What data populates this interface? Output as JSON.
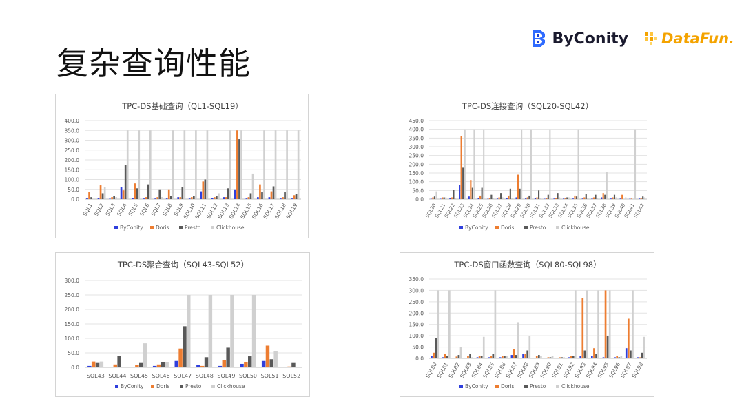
{
  "slide": {
    "title": "复杂查询性能"
  },
  "logos": {
    "byconity": "ByConity",
    "datafun": "DataFun."
  },
  "colors": {
    "ByConity": "#2f3fdc",
    "Doris": "#ed7d31",
    "Presto": "#595959",
    "Clickhouse": "#d0d0d0"
  },
  "chart_data": [
    {
      "type": "bar",
      "title": "TPC-DS基础查询（QL1-SQL19）",
      "ylim": [
        0,
        400
      ],
      "yticks": [
        "0.0",
        "50.0",
        "100.0",
        "150.0",
        "200.0",
        "250.0",
        "300.0",
        "350.0",
        "400.0"
      ],
      "legend_position": "bottom",
      "categories": [
        "SQL1",
        "SQL2",
        "SQL3",
        "SQL4",
        "SQL5",
        "SQL6",
        "SQL7",
        "SQL8",
        "SQL9",
        "SQL10",
        "SQL11",
        "SQL12",
        "SQL13",
        "SQL14",
        "SQL15",
        "SQL16",
        "SQL17",
        "SQL18",
        "SQL19"
      ],
      "series": [
        {
          "name": "ByConity",
          "values": [
            5,
            5,
            2,
            60,
            5,
            3,
            3,
            3,
            10,
            3,
            40,
            5,
            10,
            50,
            3,
            10,
            10,
            3,
            3
          ]
        },
        {
          "name": "Doris",
          "values": [
            35,
            70,
            10,
            45,
            80,
            10,
            10,
            50,
            10,
            10,
            90,
            10,
            10,
            350,
            10,
            75,
            40,
            10,
            20
          ]
        },
        {
          "name": "Presto",
          "values": [
            10,
            30,
            15,
            175,
            55,
            75,
            50,
            15,
            60,
            15,
            100,
            15,
            55,
            305,
            30,
            35,
            65,
            35,
            25
          ]
        },
        {
          "name": "Clickhouse",
          "values": [
            0,
            60,
            10,
            350,
            350,
            350,
            10,
            350,
            350,
            350,
            350,
            30,
            350,
            350,
            130,
            350,
            350,
            350,
            350
          ]
        }
      ]
    },
    {
      "type": "bar",
      "title": "TPC-DS连接查询（SQL20-SQL42）",
      "ylim": [
        0,
        450
      ],
      "yticks": [
        "0.0",
        "50.0",
        "100.0",
        "150.0",
        "200.0",
        "250.0",
        "300.0",
        "350.0",
        "400.0",
        "450.0"
      ],
      "legend_position": "bottom",
      "categories": [
        "SQL20",
        "SQL21",
        "SQL22",
        "SQL23",
        "SQL24",
        "SQL25",
        "SQL26",
        "SQL27",
        "SQL28",
        "SQL29",
        "SQL30",
        "SQL31",
        "SQL32",
        "SQL33",
        "SQL34",
        "SQL35",
        "SQL36",
        "SQL37",
        "SQL38",
        "SQL39",
        "SQL40",
        "SQL41",
        "SQL42"
      ],
      "series": [
        {
          "name": "ByConity",
          "values": [
            2,
            2,
            5,
            80,
            15,
            5,
            2,
            3,
            5,
            10,
            5,
            5,
            2,
            3,
            3,
            3,
            3,
            3,
            10,
            3,
            3,
            2,
            3
          ]
        },
        {
          "name": "Doris",
          "values": [
            10,
            10,
            10,
            360,
            110,
            20,
            5,
            10,
            20,
            140,
            10,
            10,
            5,
            5,
            5,
            20,
            10,
            10,
            35,
            10,
            25,
            3,
            5
          ]
        },
        {
          "name": "Presto",
          "values": [
            15,
            10,
            55,
            180,
            65,
            65,
            25,
            35,
            60,
            60,
            20,
            50,
            25,
            35,
            10,
            15,
            30,
            25,
            25,
            25,
            0,
            0,
            15
          ]
        },
        {
          "name": "Clickhouse",
          "values": [
            45,
            10,
            5,
            400,
            400,
            400,
            5,
            10,
            5,
            400,
            400,
            5,
            400,
            10,
            10,
            400,
            5,
            5,
            155,
            10,
            10,
            400,
            10
          ]
        }
      ]
    },
    {
      "type": "bar",
      "title": "TPC-DS聚合查询（SQL43-SQL52）",
      "ylim": [
        0,
        300
      ],
      "yticks": [
        "0.0",
        "50.0",
        "100.0",
        "150.0",
        "200.0",
        "250.0",
        "300.0"
      ],
      "legend_position": "bottom",
      "categories": [
        "SQL43",
        "SQL44",
        "SQL45",
        "SQL46",
        "SQL47",
        "SQL48",
        "SQL49",
        "SQL50",
        "SQL51",
        "SQL52"
      ],
      "series": [
        {
          "name": "ByConity",
          "values": [
            5,
            2,
            2,
            5,
            22,
            8,
            5,
            12,
            22,
            2
          ]
        },
        {
          "name": "Doris",
          "values": [
            20,
            10,
            8,
            10,
            65,
            5,
            25,
            17,
            75,
            3
          ]
        },
        {
          "name": "Presto",
          "values": [
            15,
            40,
            15,
            17,
            142,
            35,
            68,
            38,
            28,
            15
          ]
        },
        {
          "name": "Clickhouse",
          "values": [
            20,
            2,
            83,
            17,
            250,
            250,
            250,
            250,
            57,
            2
          ]
        }
      ]
    },
    {
      "type": "bar",
      "title": "TPC-DS窗口函数查询（SQL80-SQL98）",
      "ylim": [
        0,
        350
      ],
      "yticks": [
        "0.0",
        "50.0",
        "100.0",
        "150.0",
        "200.0",
        "250.0",
        "300.0",
        "350.0"
      ],
      "legend_position": "bottom",
      "categories": [
        "SQL80",
        "SQL81",
        "SQL82",
        "SQL83",
        "SQL84",
        "SQL85",
        "SQL86",
        "SQL87",
        "SQL88",
        "SQL89",
        "SQL90",
        "SQL91",
        "SQL92",
        "SQL93",
        "SQL94",
        "SQL95",
        "SQL96",
        "SQL97",
        "SQL98"
      ],
      "series": [
        {
          "name": "ByConity",
          "values": [
            10,
            5,
            3,
            3,
            5,
            5,
            5,
            15,
            20,
            3,
            3,
            2,
            5,
            10,
            10,
            5,
            5,
            45,
            5
          ]
        },
        {
          "name": "Doris",
          "values": [
            25,
            20,
            8,
            10,
            10,
            10,
            10,
            40,
            20,
            10,
            5,
            5,
            10,
            265,
            45,
            300,
            10,
            175,
            5
          ]
        },
        {
          "name": "Presto",
          "values": [
            90,
            10,
            15,
            20,
            10,
            20,
            10,
            15,
            35,
            15,
            5,
            5,
            10,
            35,
            20,
            100,
            5,
            35,
            25
          ]
        },
        {
          "name": "Clickhouse",
          "values": [
            300,
            300,
            50,
            5,
            95,
            300,
            10,
            160,
            100,
            10,
            10,
            5,
            300,
            300,
            300,
            300,
            10,
            300,
            95
          ]
        }
      ]
    }
  ]
}
